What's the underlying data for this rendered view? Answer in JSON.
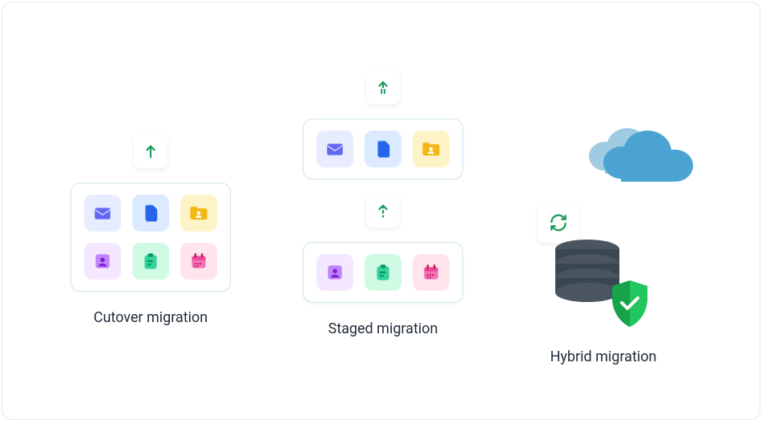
{
  "columns": {
    "cutover": {
      "label": "Cutover migration"
    },
    "staged": {
      "label": "Staged migration"
    },
    "hybrid": {
      "label": "Hybrid migration"
    }
  },
  "icons": {
    "arrow_up": "arrow-up",
    "arrow_up_pause": "arrow-up-pause",
    "arrow_up_dashed": "arrow-up-dashed",
    "sync": "sync",
    "cloud": "cloud",
    "database": "database",
    "shield_check": "shield-check",
    "mail": "mail",
    "file": "file",
    "folder_user": "folder-user",
    "contact": "contact",
    "task": "task",
    "calendar": "calendar"
  },
  "colors": {
    "green": "#1b9e5a",
    "blue": "#3b82f6",
    "blue_dark": "#2563eb",
    "cloud_blue": "#4aa3d1",
    "cloud_blue_light": "#9fcbe3",
    "yellow": "#f5b714",
    "purple": "#a855f7",
    "teal": "#10b981",
    "pink": "#ec4899",
    "db_dark": "#3a4750",
    "shield_green": "#22c55e"
  }
}
